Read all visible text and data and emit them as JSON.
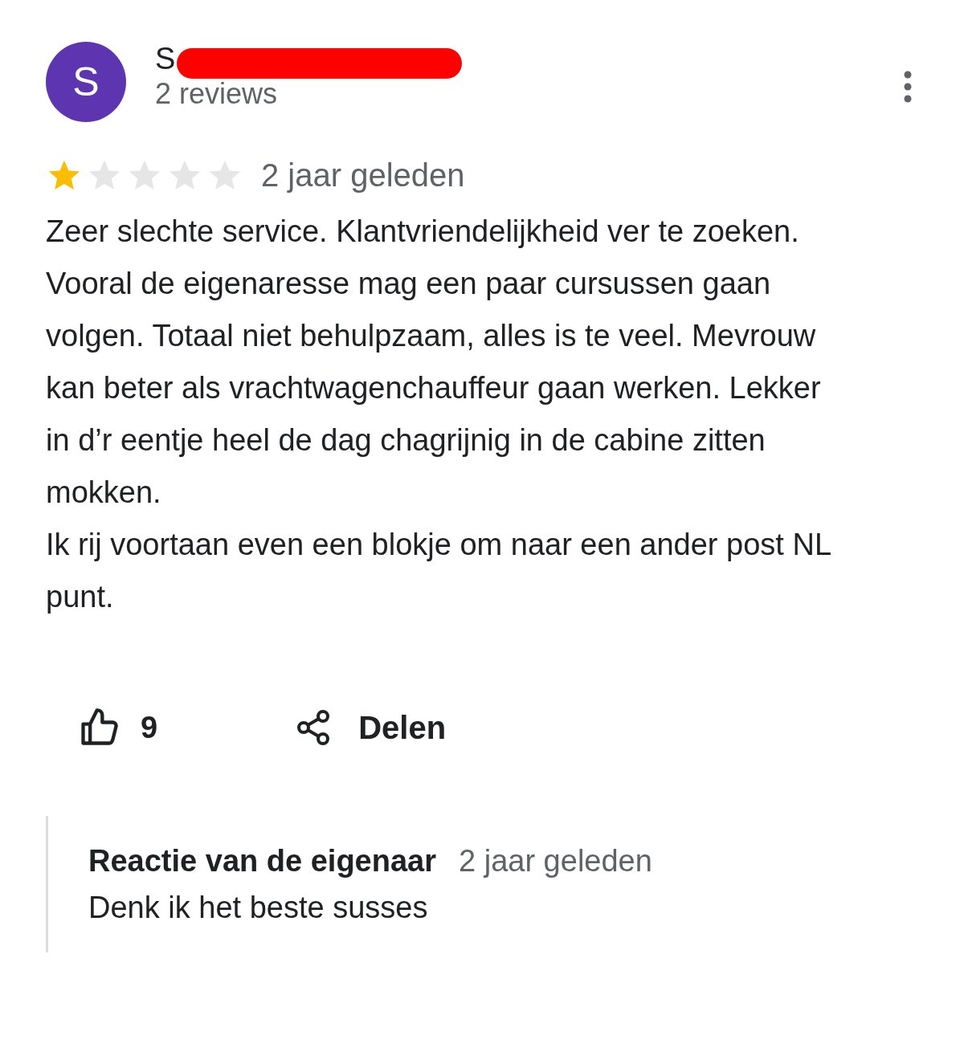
{
  "review": {
    "avatar_initial": "S",
    "author_name": "S",
    "review_count": "2 reviews",
    "stars": 1,
    "time": "2 jaar geleden",
    "text": "Zeer slechte service. Klantvriendelijkheid ver te zoeken. Vooral de eigenaresse mag een paar cursussen gaan volgen. Totaal niet behulpzaam, alles is te veel. Mevrouw kan beter als vrachtwagenchauffeur gaan werken. Lekker in d’r eentje heel de dag chagrijnig in de cabine zitten mokken.\nIk rij voortaan even een blokje om naar een ander post NL punt.",
    "likes": "9",
    "share_label": "Delen"
  },
  "owner_reply": {
    "title": "Reactie van de eigenaar",
    "time": "2 jaar geleden",
    "text": "Denk ik het beste susses"
  }
}
